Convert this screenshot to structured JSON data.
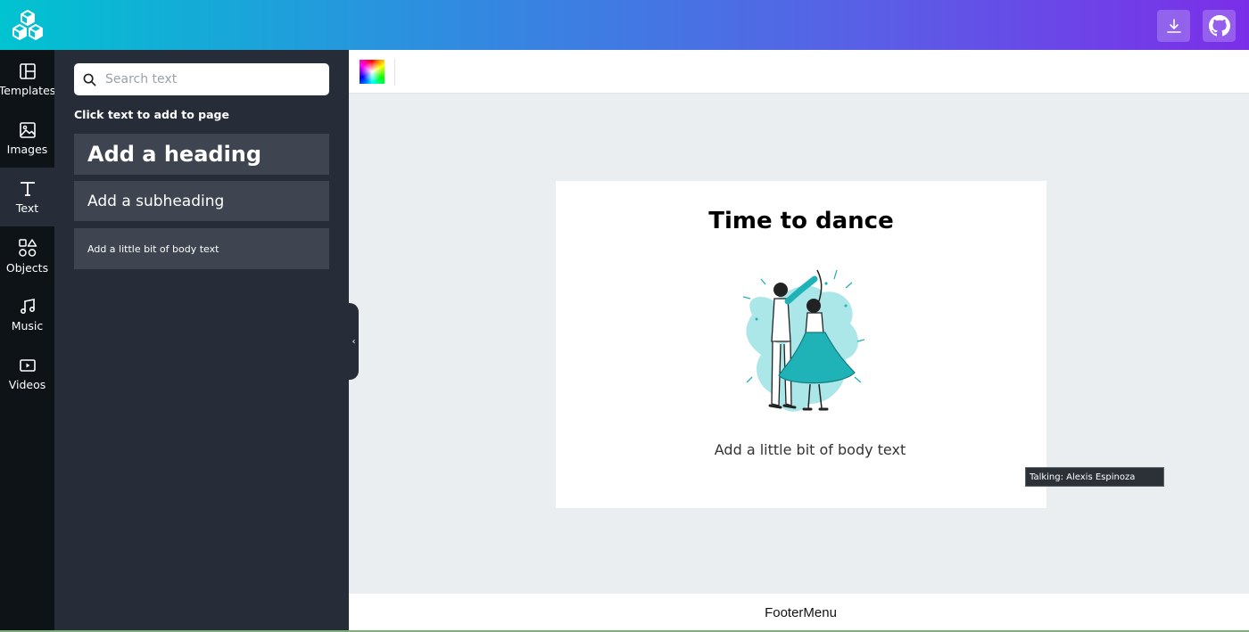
{
  "header": {
    "logo_icon": "cubes-logo-icon",
    "download_icon": "download-icon",
    "github_icon": "github-icon"
  },
  "rail": {
    "items": [
      {
        "label": "Templates",
        "icon": "layout-icon"
      },
      {
        "label": "Images",
        "icon": "image-icon"
      },
      {
        "label": "Text",
        "icon": "text-icon"
      },
      {
        "label": "Objects",
        "icon": "shapes-icon"
      },
      {
        "label": "Music",
        "icon": "music-icon"
      },
      {
        "label": "Videos",
        "icon": "video-icon"
      }
    ],
    "active": "Text"
  },
  "panel": {
    "search_placeholder": "Search text",
    "caption": "Click text to add to page",
    "heading": "Add a heading",
    "subheading": "Add a subheading",
    "body": "Add a little bit of body text"
  },
  "canvas": {
    "title": "Time to dance",
    "body": "Add a little bit of body text"
  },
  "tooltip": "Talking: Alexis Espinoza",
  "footer": "FooterMenu",
  "colors": {
    "gradient_start": "#00c3d0",
    "gradient_end": "#7b2ee8",
    "panel": "#272d38",
    "rail": "#0e1318",
    "accent_illustration": "#1fb3b8"
  }
}
